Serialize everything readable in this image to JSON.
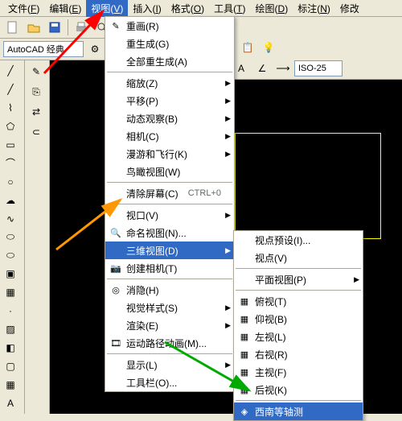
{
  "menubar": {
    "items": [
      {
        "label": "文件",
        "accel": "F"
      },
      {
        "label": "编辑",
        "accel": "E"
      },
      {
        "label": "视图",
        "accel": "V"
      },
      {
        "label": "插入",
        "accel": "I"
      },
      {
        "label": "格式",
        "accel": "O"
      },
      {
        "label": "工具",
        "accel": "T"
      },
      {
        "label": "绘图",
        "accel": "D"
      },
      {
        "label": "标注",
        "accel": "N"
      },
      {
        "label": "修改"
      }
    ],
    "active_index": 2
  },
  "workspace": {
    "selected": "AutoCAD 经典"
  },
  "dimstyle": {
    "selected": "ISO-25"
  },
  "view_menu": {
    "groups": [
      {
        "items": [
          {
            "icon": "redraw",
            "label": "重画",
            "accel": "R"
          },
          {
            "label": "重生成",
            "accel": "G"
          },
          {
            "label": "全部重生成",
            "accel": "A"
          }
        ]
      },
      {
        "items": [
          {
            "label": "缩放",
            "accel": "Z",
            "submenu": true
          },
          {
            "label": "平移",
            "accel": "P",
            "submenu": true
          },
          {
            "label": "动态观察",
            "accel": "B",
            "submenu": true
          },
          {
            "label": "相机",
            "accel": "C",
            "submenu": true
          },
          {
            "label": "漫游和飞行",
            "accel": "K",
            "submenu": true
          },
          {
            "label": "鸟瞰视图",
            "accel": "W"
          }
        ]
      },
      {
        "items": [
          {
            "label": "清除屏幕",
            "accel": "C",
            "shortcut": "CTRL+0"
          }
        ]
      },
      {
        "items": [
          {
            "label": "视口",
            "accel": "V",
            "submenu": true
          },
          {
            "icon": "named-views",
            "label": "命名视图",
            "accel": "N",
            "ellipsis": true
          },
          {
            "label": "三维视图",
            "accel": "D",
            "submenu": true,
            "highlighted": true
          },
          {
            "icon": "camera",
            "label": "创建相机",
            "accel": "T"
          }
        ]
      },
      {
        "items": [
          {
            "icon": "hide",
            "label": "消隐",
            "accel": "H"
          },
          {
            "label": "视觉样式",
            "accel": "S",
            "submenu": true
          },
          {
            "label": "渲染",
            "accel": "E",
            "submenu": true
          },
          {
            "icon": "motion",
            "label": "运动路径动画",
            "accel": "M",
            "ellipsis": true
          }
        ]
      },
      {
        "items": [
          {
            "label": "显示",
            "accel": "L",
            "submenu": true
          },
          {
            "label": "工具栏",
            "accel": "O",
            "ellipsis": true
          }
        ]
      }
    ]
  },
  "submenu_3d": {
    "groups": [
      {
        "items": [
          {
            "label": "视点预设",
            "accel": "I",
            "ellipsis": true
          },
          {
            "label": "视点",
            "accel": "V"
          }
        ]
      },
      {
        "items": [
          {
            "label": "平面视图",
            "accel": "P",
            "submenu": true
          }
        ]
      },
      {
        "items": [
          {
            "icon": "cube",
            "label": "俯视",
            "accel": "T"
          },
          {
            "icon": "cube",
            "label": "仰视",
            "accel": "B"
          },
          {
            "icon": "cube",
            "label": "左视",
            "accel": "L"
          },
          {
            "icon": "cube",
            "label": "右视",
            "accel": "R"
          },
          {
            "icon": "cube",
            "label": "主视",
            "accel": "F"
          },
          {
            "icon": "cube",
            "label": "后视",
            "accel": "K"
          }
        ]
      },
      {
        "items": [
          {
            "icon": "cube-iso",
            "label": "西南等轴测",
            "highlighted": true
          }
        ]
      }
    ]
  }
}
